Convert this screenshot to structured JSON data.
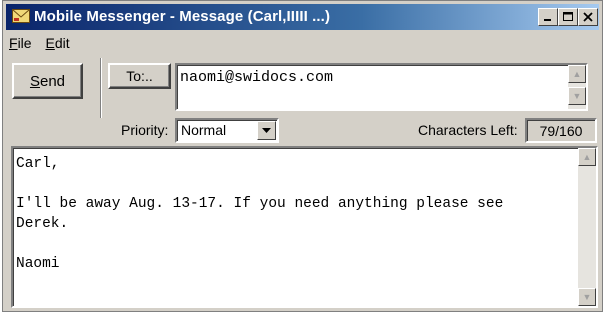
{
  "window": {
    "title": "Mobile Messenger - Message (Carl,IIIII ...)",
    "buttons": [
      "minimize",
      "maximize",
      "close"
    ]
  },
  "menu": {
    "items": [
      {
        "label": "File",
        "mnemonic": "F",
        "rest": "ile"
      },
      {
        "label": "Edit",
        "mnemonic": "E",
        "rest": "dit"
      }
    ]
  },
  "toolbar": {
    "send_label": "Send",
    "send_mnemonic": "S",
    "send_rest": "end",
    "to_label": "To:.."
  },
  "recipient": {
    "value": "naomi@swidocs.com"
  },
  "options": {
    "priority_label": "Priority:",
    "priority_value": "Normal",
    "chars_left_label": "Characters Left:",
    "chars_left_value": "79/160"
  },
  "message": {
    "body": "Carl,\n\nI'll be away Aug. 13-17. If you need anything please see\nDerek.\n\nNaomi"
  },
  "colors": {
    "titlebar_start": "#0a246a",
    "titlebar_end": "#a6caf0",
    "face": "#d4d0c8"
  }
}
